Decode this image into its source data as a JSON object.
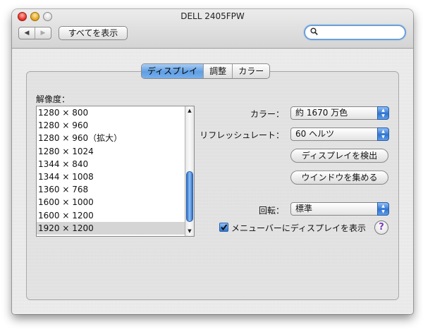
{
  "window": {
    "title": "DELL 2405FPW"
  },
  "toolbar": {
    "back_icon": "◀",
    "forward_icon": "▶",
    "show_all_label": "すべてを表示",
    "search_placeholder": ""
  },
  "tabs": [
    {
      "label": "ディスプレイ",
      "active": true
    },
    {
      "label": "調整",
      "active": false
    },
    {
      "label": "カラー",
      "active": false
    }
  ],
  "resolutions": {
    "label": "解像度：",
    "items": [
      "1280 × 800",
      "1280 × 960",
      "1280 × 960（拡大）",
      "1280 × 1024",
      "1344 × 840",
      "1344 × 1008",
      "1360 × 768",
      "1600 × 1000",
      "1600 × 1200",
      "1920 × 1200"
    ],
    "selected": "1920 × 1200"
  },
  "settings": {
    "colors_label": "カラー：",
    "colors_value": "約 1670 万色",
    "refresh_label": "リフレッシュレート：",
    "refresh_value": "60 ヘルツ",
    "detect_button": "ディスプレイを検出",
    "gather_button": "ウインドウを集める",
    "rotation_label": "回転：",
    "rotation_value": "標準",
    "show_menubar_label": "メニューバーにディスプレイを表示",
    "show_menubar_checked": true,
    "help_glyph": "?"
  },
  "colors": {
    "accent": "#2f74cf",
    "selected_row": "#d5d5d5",
    "help": "#7b3bb3"
  }
}
